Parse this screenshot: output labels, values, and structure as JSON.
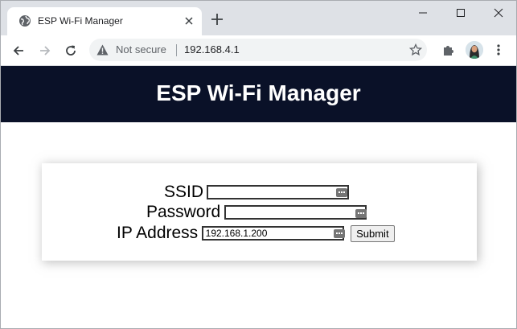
{
  "browser": {
    "tab": {
      "title": "ESP Wi-Fi Manager"
    },
    "address_bar": {
      "security_label": "Not secure",
      "url": "192.168.4.1"
    }
  },
  "page": {
    "header": {
      "title": "ESP Wi-Fi Manager"
    },
    "form": {
      "ssid": {
        "label": "SSID",
        "value": ""
      },
      "password": {
        "label": "Password",
        "value": ""
      },
      "ip": {
        "label": "IP Address",
        "value": "192.168.1.200"
      },
      "submit_label": "Submit"
    }
  },
  "colors": {
    "header_bg": "#0a1128",
    "tabstrip_bg": "#dee1e6",
    "omnibox_bg": "#f1f3f4"
  },
  "icons": [
    "globe-icon",
    "close-icon",
    "plus-icon",
    "minimize-icon",
    "maximize-icon",
    "back-icon",
    "forward-icon",
    "reload-icon",
    "warning-icon",
    "star-icon",
    "puzzle-icon",
    "avatar",
    "kebab-menu-icon",
    "password-key-icon"
  ]
}
